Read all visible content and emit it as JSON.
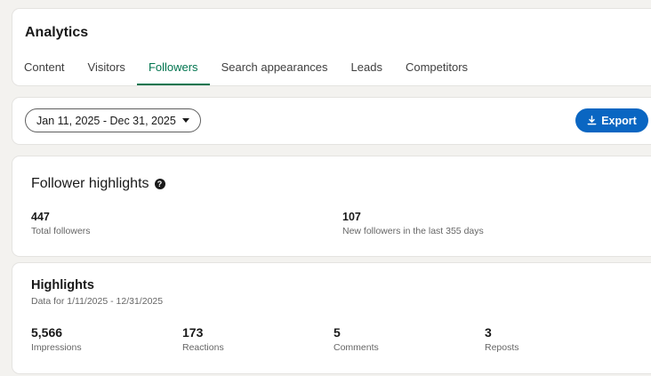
{
  "header": {
    "title": "Analytics",
    "tabs": [
      {
        "label": "Content",
        "active": false
      },
      {
        "label": "Visitors",
        "active": false
      },
      {
        "label": "Followers",
        "active": true
      },
      {
        "label": "Search appearances",
        "active": false
      },
      {
        "label": "Leads",
        "active": false
      },
      {
        "label": "Competitors",
        "active": false
      }
    ]
  },
  "filter": {
    "date_range": "Jan 11, 2025 - Dec 31, 2025",
    "export_label": "Export",
    "export_icon": "download-icon"
  },
  "follower_highlights": {
    "title": "Follower highlights",
    "help_icon": "question-icon",
    "metrics": [
      {
        "value": "447",
        "label": "Total followers"
      },
      {
        "value": "107",
        "label": "New followers in the last 355 days"
      }
    ]
  },
  "highlights": {
    "title": "Highlights",
    "subtitle": "Data for 1/11/2025 - 12/31/2025",
    "metrics": [
      {
        "value": "5,566",
        "label": "Impressions"
      },
      {
        "value": "173",
        "label": "Reactions"
      },
      {
        "value": "5",
        "label": "Comments"
      },
      {
        "value": "3",
        "label": "Reposts"
      }
    ]
  },
  "colors": {
    "accent_green": "#01754f",
    "primary_blue": "#0a66c2",
    "page_bg": "#f3f2ef"
  }
}
